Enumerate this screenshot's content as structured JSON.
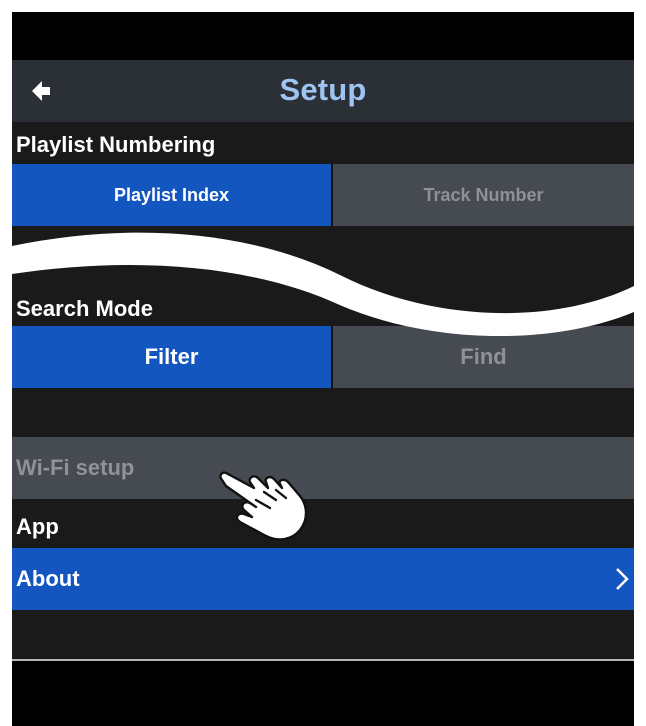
{
  "nav": {
    "title": "Setup"
  },
  "playlist_numbering": {
    "label": "Playlist Numbering",
    "options": [
      "Playlist Index",
      "Track Number"
    ],
    "selected": "Playlist Index"
  },
  "search_mode": {
    "label": "Search Mode",
    "options": [
      "Filter",
      "Find"
    ],
    "selected": "Filter"
  },
  "wifi": {
    "label": "Wi-Fi setup"
  },
  "app": {
    "label": "App",
    "about_label": "About"
  },
  "colors": {
    "accent": "#1356c0",
    "title": "#9fc4f2",
    "background": "#1a1a1a",
    "inactive": "#464b51"
  },
  "icons": [
    "back-arrow-icon",
    "chevron-right-icon",
    "pointing-hand-icon"
  ]
}
